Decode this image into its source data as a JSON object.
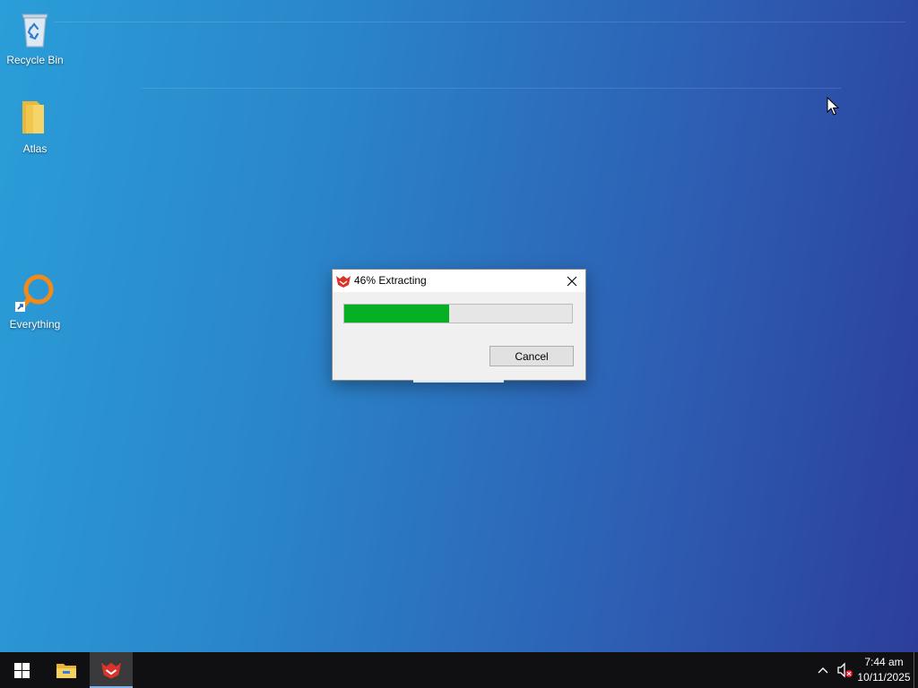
{
  "desktop": {
    "icons": [
      {
        "label": "Recycle Bin",
        "icon": "recycle-bin-icon"
      },
      {
        "label": "Atlas",
        "icon": "folder-icon"
      },
      {
        "label": "Everything",
        "icon": "everything-search-icon"
      }
    ]
  },
  "dialog": {
    "title": "46% Extracting",
    "progress_percent": 46,
    "cancel_label": "Cancel",
    "app_icon": "archiver-icon",
    "close_icon": "close-icon"
  },
  "taskbar": {
    "start_icon": "windows-start-icon",
    "pinned": [
      {
        "icon": "file-explorer-icon",
        "active": false
      },
      {
        "icon": "archiver-icon",
        "active": true
      }
    ],
    "tray": {
      "chevron_icon": "chevron-up-icon",
      "volume_icon": "volume-muted-icon"
    },
    "clock": {
      "time": "7:44 am",
      "date": "10/11/2025"
    }
  },
  "colors": {
    "progress_fill": "#06b025",
    "taskbar_bg": "#101012"
  }
}
